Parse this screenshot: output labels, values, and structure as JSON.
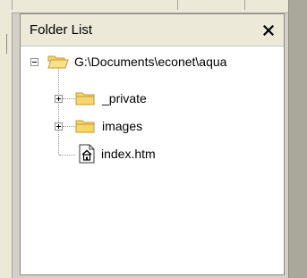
{
  "panel": {
    "title": "Folder List",
    "close_glyph": "✕"
  },
  "tree": {
    "root": {
      "label": "G:\\Documents\\econet\\aqua",
      "icon": "folder-open-icon",
      "expanded": true
    },
    "children": [
      {
        "label": "_private",
        "icon": "folder-icon",
        "expandable": true
      },
      {
        "label": "images",
        "icon": "folder-icon",
        "expandable": true
      },
      {
        "label": "index.htm",
        "icon": "home-page-icon",
        "expandable": false
      }
    ]
  },
  "colors": {
    "folder_fill": "#f5d76e",
    "folder_stroke": "#c79a2a",
    "panel_header": "#ece9d8"
  }
}
